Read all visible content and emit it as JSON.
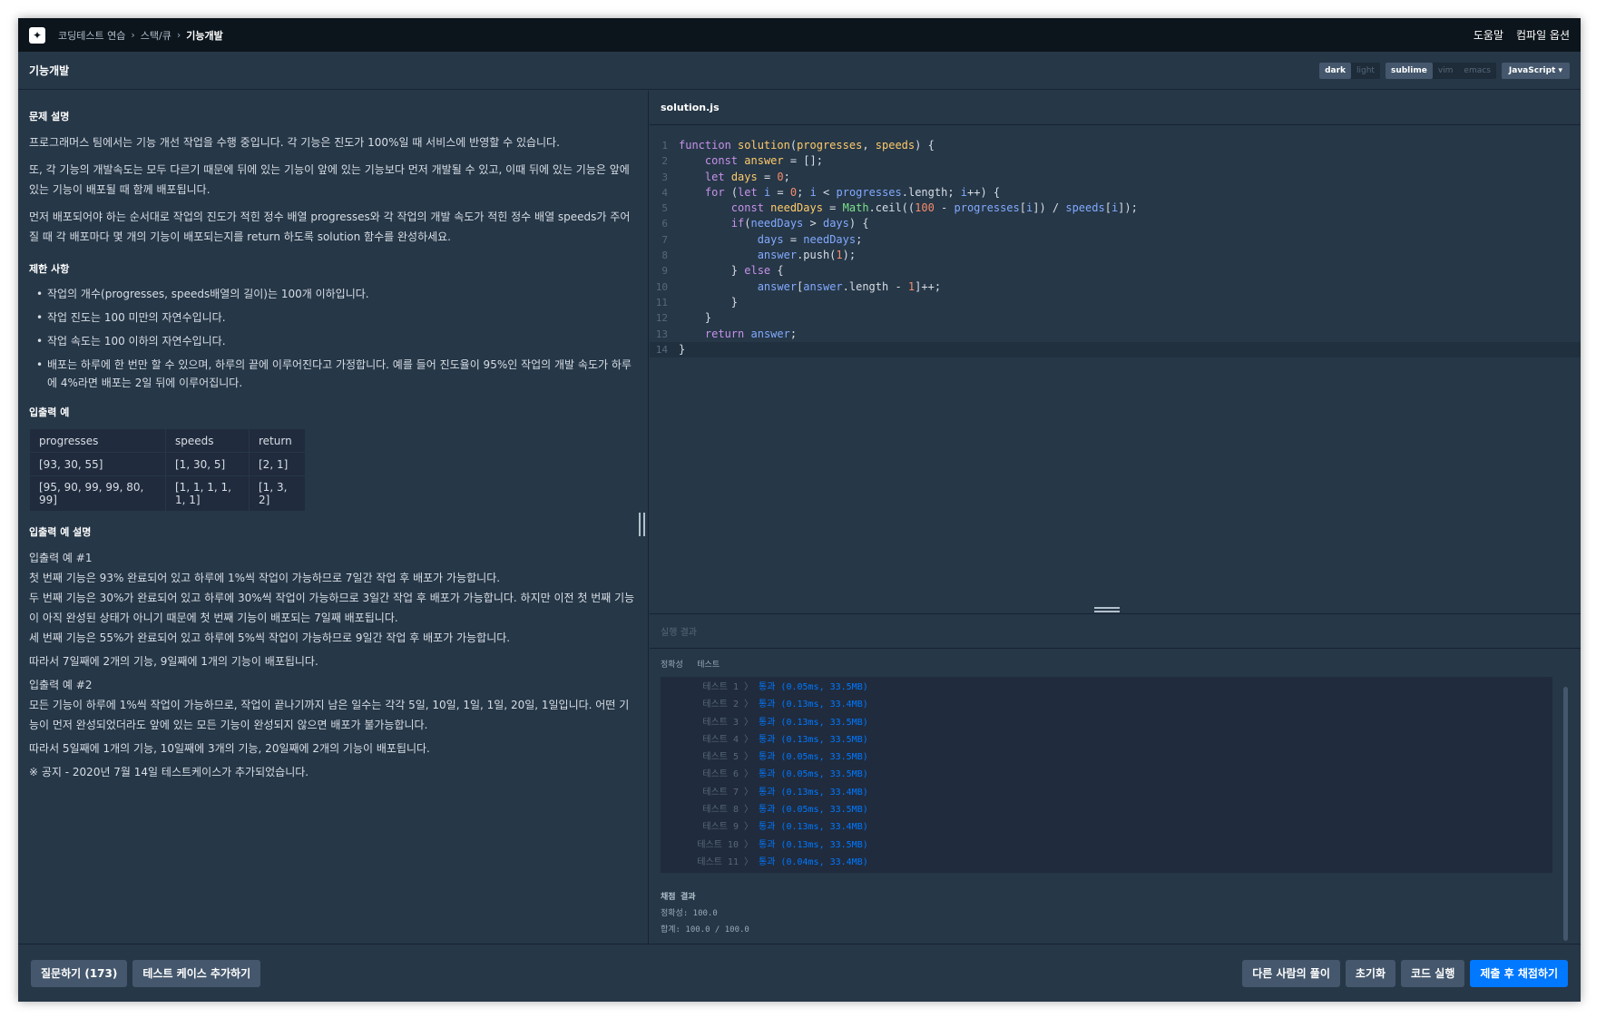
{
  "topbar": {
    "logo_glyph": "✦",
    "breadcrumb": [
      "코딩테스트 연습",
      "스택/큐",
      "기능개발"
    ],
    "help": "도움말",
    "compile_options": "컴파일 옵션"
  },
  "header": {
    "title": "기능개발",
    "theme_options": [
      "dark",
      "light"
    ],
    "keymap_options": [
      "sublime",
      "vim",
      "emacs"
    ],
    "language": "JavaScript ▾"
  },
  "problem": {
    "desc_title": "문제 설명",
    "desc": [
      "프로그래머스 팀에서는 기능 개선 작업을 수행 중입니다. 각 기능은 진도가 100%일 때 서비스에 반영할 수 있습니다.",
      "또, 각 기능의 개발속도는 모두 다르기 때문에 뒤에 있는 기능이 앞에 있는 기능보다 먼저 개발될 수 있고, 이때 뒤에 있는 기능은 앞에 있는 기능이 배포될 때 함께 배포됩니다.",
      "먼저 배포되어야 하는 순서대로 작업의 진도가 적힌 정수 배열 progresses와 각 작업의 개발 속도가 적힌 정수 배열 speeds가 주어질 때 각 배포마다 몇 개의 기능이 배포되는지를 return 하도록 solution 함수를 완성하세요."
    ],
    "constraints_title": "제한 사항",
    "constraints": [
      "작업의 개수(progresses, speeds배열의 길이)는 100개 이하입니다.",
      "작업 진도는 100 미만의 자연수입니다.",
      "작업 속도는 100 이하의 자연수입니다.",
      "배포는 하루에 한 번만 할 수 있으며, 하루의 끝에 이루어진다고 가정합니다. 예를 들어 진도율이 95%인 작업의 개발 속도가 하루에 4%라면 배포는 2일 뒤에 이루어집니다."
    ],
    "io_title": "입출력 예",
    "io_headers": [
      "progresses",
      "speeds",
      "return"
    ],
    "io_rows": [
      [
        "[93, 30, 55]",
        "[1, 30, 5]",
        "[2, 1]"
      ],
      [
        "[95, 90, 99, 99, 80, 99]",
        "[1, 1, 1, 1, 1, 1]",
        "[1, 3, 2]"
      ]
    ],
    "io_explain_title": "입출력 예 설명",
    "ex1_title": "입출력 예 #1",
    "ex1_lines": [
      "첫 번째 기능은 93% 완료되어 있고 하루에 1%씩 작업이 가능하므로 7일간 작업 후 배포가 가능합니다.",
      "두 번째 기능은 30%가 완료되어 있고 하루에 30%씩 작업이 가능하므로 3일간 작업 후 배포가 가능합니다. 하지만 이전 첫 번째 기능이 아직 완성된 상태가 아니기 때문에 첫 번째 기능이 배포되는 7일째 배포됩니다.",
      "세 번째 기능은 55%가 완료되어 있고 하루에 5%씩 작업이 가능하므로 9일간 작업 후 배포가 가능합니다."
    ],
    "ex1_conclusion": "따라서 7일째에 2개의 기능, 9일째에 1개의 기능이 배포됩니다.",
    "ex2_title": "입출력 예 #2",
    "ex2_line": "모든 기능이 하루에 1%씩 작업이 가능하므로, 작업이 끝나기까지 남은 일수는 각각 5일, 10일, 1일, 1일, 20일, 1일입니다. 어떤 기능이 먼저 완성되었더라도 앞에 있는 모든 기능이 완성되지 않으면 배포가 불가능합니다.",
    "ex2_conclusion": "따라서 5일째에 1개의 기능, 10일째에 3개의 기능, 20일째에 2개의 기능이 배포됩니다.",
    "notice": "※ 공지 - 2020년 7월 14일 테스트케이스가 추가되었습니다."
  },
  "editor": {
    "filename": "solution.js"
  },
  "result": {
    "title": "실행 결과",
    "tabs": [
      "정확성",
      "테스트"
    ],
    "tests": [
      {
        "label": "테스트 1 〉",
        "value": "통과 (0.05ms, 33.5MB)"
      },
      {
        "label": "테스트 2 〉",
        "value": "통과 (0.13ms, 33.4MB)"
      },
      {
        "label": "테스트 3 〉",
        "value": "통과 (0.13ms, 33.5MB)"
      },
      {
        "label": "테스트 4 〉",
        "value": "통과 (0.13ms, 33.5MB)"
      },
      {
        "label": "테스트 5 〉",
        "value": "통과 (0.05ms, 33.5MB)"
      },
      {
        "label": "테스트 6 〉",
        "value": "통과 (0.05ms, 33.5MB)"
      },
      {
        "label": "테스트 7 〉",
        "value": "통과 (0.13ms, 33.4MB)"
      },
      {
        "label": "테스트 8 〉",
        "value": "통과 (0.05ms, 33.5MB)"
      },
      {
        "label": "테스트 9 〉",
        "value": "통과 (0.13ms, 33.4MB)"
      },
      {
        "label": "테스트 10 〉",
        "value": "통과 (0.13ms, 33.5MB)"
      },
      {
        "label": "테스트 11 〉",
        "value": "통과 (0.04ms, 33.4MB)"
      }
    ],
    "grade_title": "채점 결과",
    "accuracy": "정확성: 100.0",
    "total": "합계: 100.0 / 100.0"
  },
  "bottom": {
    "ask": "질문하기 (173)",
    "add_test": "테스트 케이스 추가하기",
    "others": "다른 사람의 풀이",
    "reset": "초기화",
    "run": "코드 실행",
    "submit": "제출 후 채점하기"
  }
}
